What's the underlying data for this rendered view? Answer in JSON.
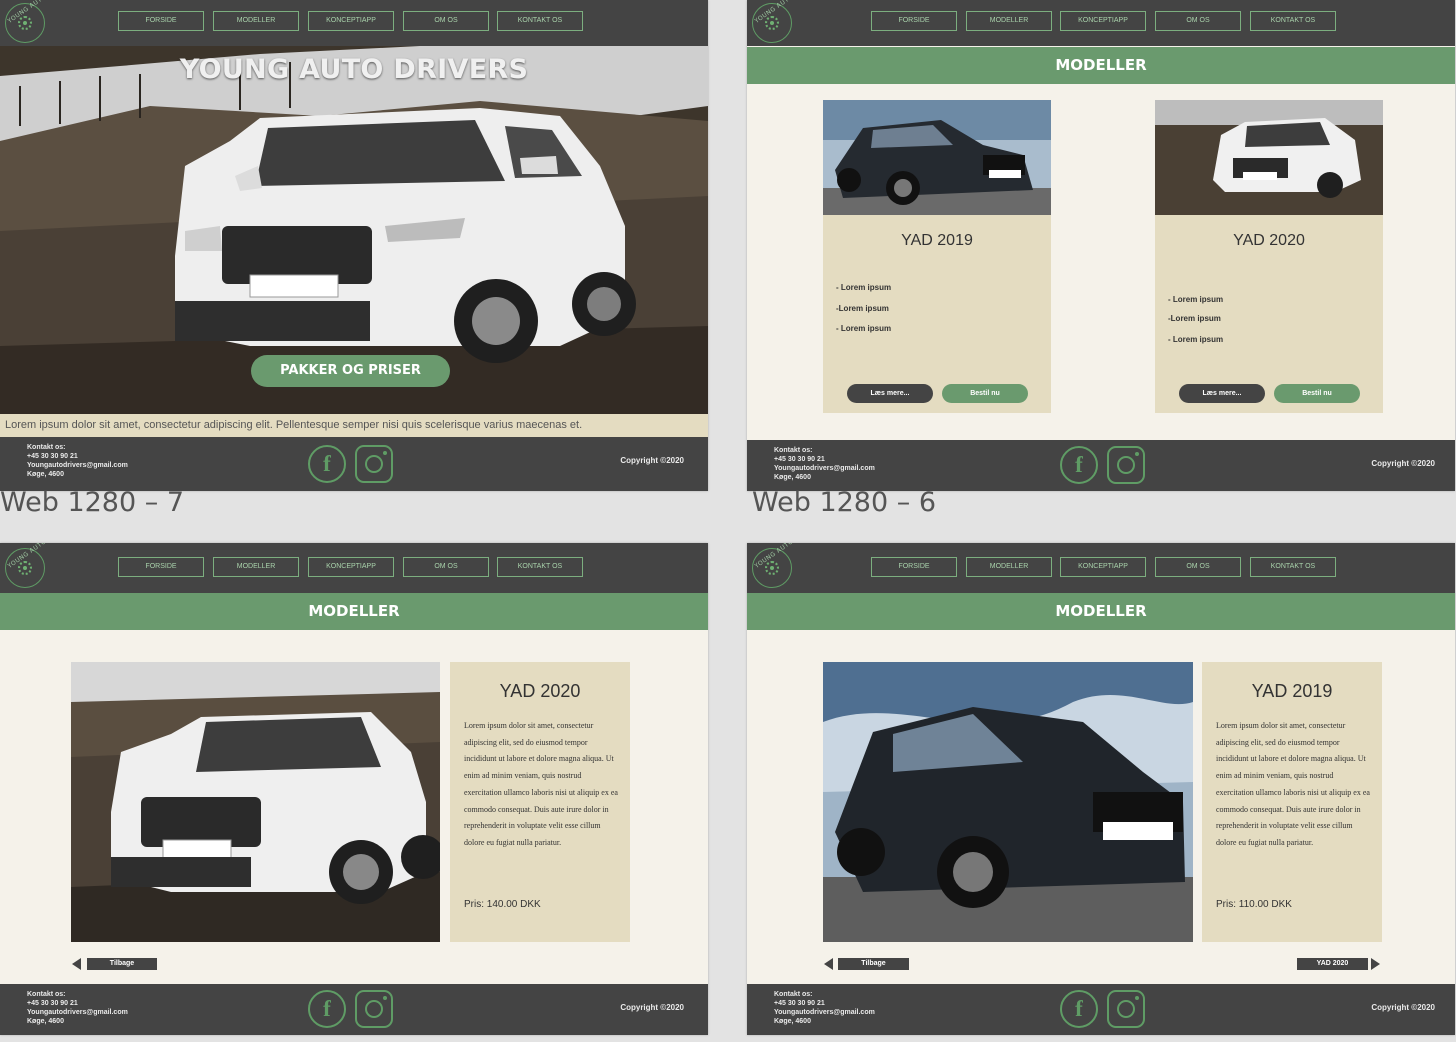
{
  "nav": [
    "FORSIDE",
    "MODELLER",
    "KONCEPTIAPP",
    "OM OS",
    "KONTAKT OS"
  ],
  "logo_text": "YOUNG AUTO DRIVERS",
  "footer": {
    "contact_heading": "Kontakt os:",
    "phone": "+45 30 30 90 21",
    "email": "Youngautodrivers@gmail.com",
    "city": "Køge, 4600",
    "copyright": "Copyright ©2020",
    "facebook_glyph": "f"
  },
  "artboards": {
    "home_label": "Web 1280 – 7",
    "models_label": "Web 1280 – 6"
  },
  "home": {
    "title": "YOUNG AUTO DRIVERS",
    "cta": "PAKKER OG PRISER",
    "lorem": "Lorem ipsum dolor sit amet, consectetur adipiscing elit. Pellentesque semper nisi quis scelerisque varius maecenas et."
  },
  "models": {
    "heading": "MODELLER",
    "cards": [
      {
        "title": "YAD 2019",
        "features": [
          "- Lorem ipsum",
          "-Lorem ipsum",
          "- Lorem ipsum"
        ],
        "read_more": "Læs mere...",
        "order": "Bestil nu"
      },
      {
        "title": "YAD 2020",
        "features": [
          "- Lorem ipsum",
          "-Lorem ipsum",
          "- Lorem ipsum"
        ],
        "read_more": "Læs mere...",
        "order": "Bestil nu"
      }
    ]
  },
  "detail_2020": {
    "heading": "MODELLER",
    "title": "YAD 2020",
    "text": "Lorem ipsum dolor sit amet, consectetur adipiscing elit, sed do eiusmod tempor incididunt ut labore et dolore magna aliqua. Ut enim ad minim veniam, quis nostrud exercitation ullamco laboris nisi ut aliquip ex ea commodo consequat. Duis aute irure dolor in reprehenderit in voluptate velit esse cillum dolore eu fugiat nulla pariatur.",
    "price": "Pris: 140.00 DKK",
    "back": "Tilbage"
  },
  "detail_2019": {
    "heading": "MODELLER",
    "title": "YAD 2019",
    "text": "Lorem ipsum dolor sit amet, consectetur adipiscing elit, sed do eiusmod tempor incididunt ut labore et dolore magna aliqua. Ut enim ad minim veniam, quis nostrud exercitation ullamco laboris nisi ut aliquip ex ea commodo consequat. Duis aute irure dolor in reprehenderit in voluptate velit esse cillum dolore eu fugiat nulla pariatur.",
    "price": "Pris: 110.00 DKK",
    "back": "Tilbage",
    "next": "YAD 2020"
  },
  "colors": {
    "dark": "#444444",
    "green": "#6a9a6e",
    "beige": "#e4dcc1",
    "cream": "#f5f2ea"
  }
}
